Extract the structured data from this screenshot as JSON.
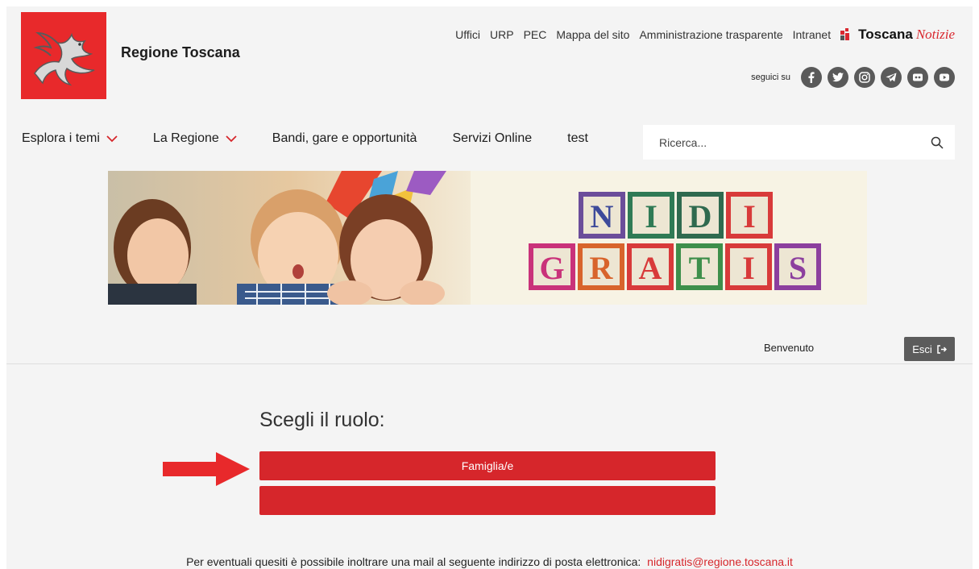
{
  "header": {
    "site_name": "Regione Toscana",
    "top_links": [
      "Uffici",
      "URP",
      "PEC",
      "Mappa del sito",
      "Amministrazione trasparente",
      "Intranet"
    ],
    "toscana_notizie": {
      "bold": "Toscana",
      "italic": "Notizie"
    },
    "follow_label": "seguici su",
    "social_icons": [
      "facebook-icon",
      "twitter-icon",
      "instagram-icon",
      "telegram-icon",
      "flickr-icon",
      "youtube-icon"
    ],
    "accent_color": "#e8292b"
  },
  "nav": {
    "items": [
      {
        "label": "Esplora i temi",
        "dropdown": true
      },
      {
        "label": "La Regione",
        "dropdown": true
      },
      {
        "label": "Bandi, gare e opportunità",
        "dropdown": false
      },
      {
        "label": "Servizi Online",
        "dropdown": false
      },
      {
        "label": "test",
        "dropdown": false
      }
    ],
    "search_placeholder": "Ricerca..."
  },
  "banner": {
    "blocks_row1": [
      "N",
      "I",
      "D",
      "I"
    ],
    "blocks_row2": [
      "G",
      "R",
      "A",
      "T",
      "I",
      "S"
    ]
  },
  "user_bar": {
    "welcome": "Benvenuto",
    "logout_label": "Esci"
  },
  "main": {
    "title": "Scegli il ruolo:",
    "role_buttons": [
      "Famiglia/e",
      ""
    ],
    "button_color": "#d6262b"
  },
  "footer": {
    "note": "Per eventuali quesiti è possibile inoltrare una mail al seguente indirizzo di posta elettronica:",
    "email": "nidigratis@regione.toscana.it"
  }
}
